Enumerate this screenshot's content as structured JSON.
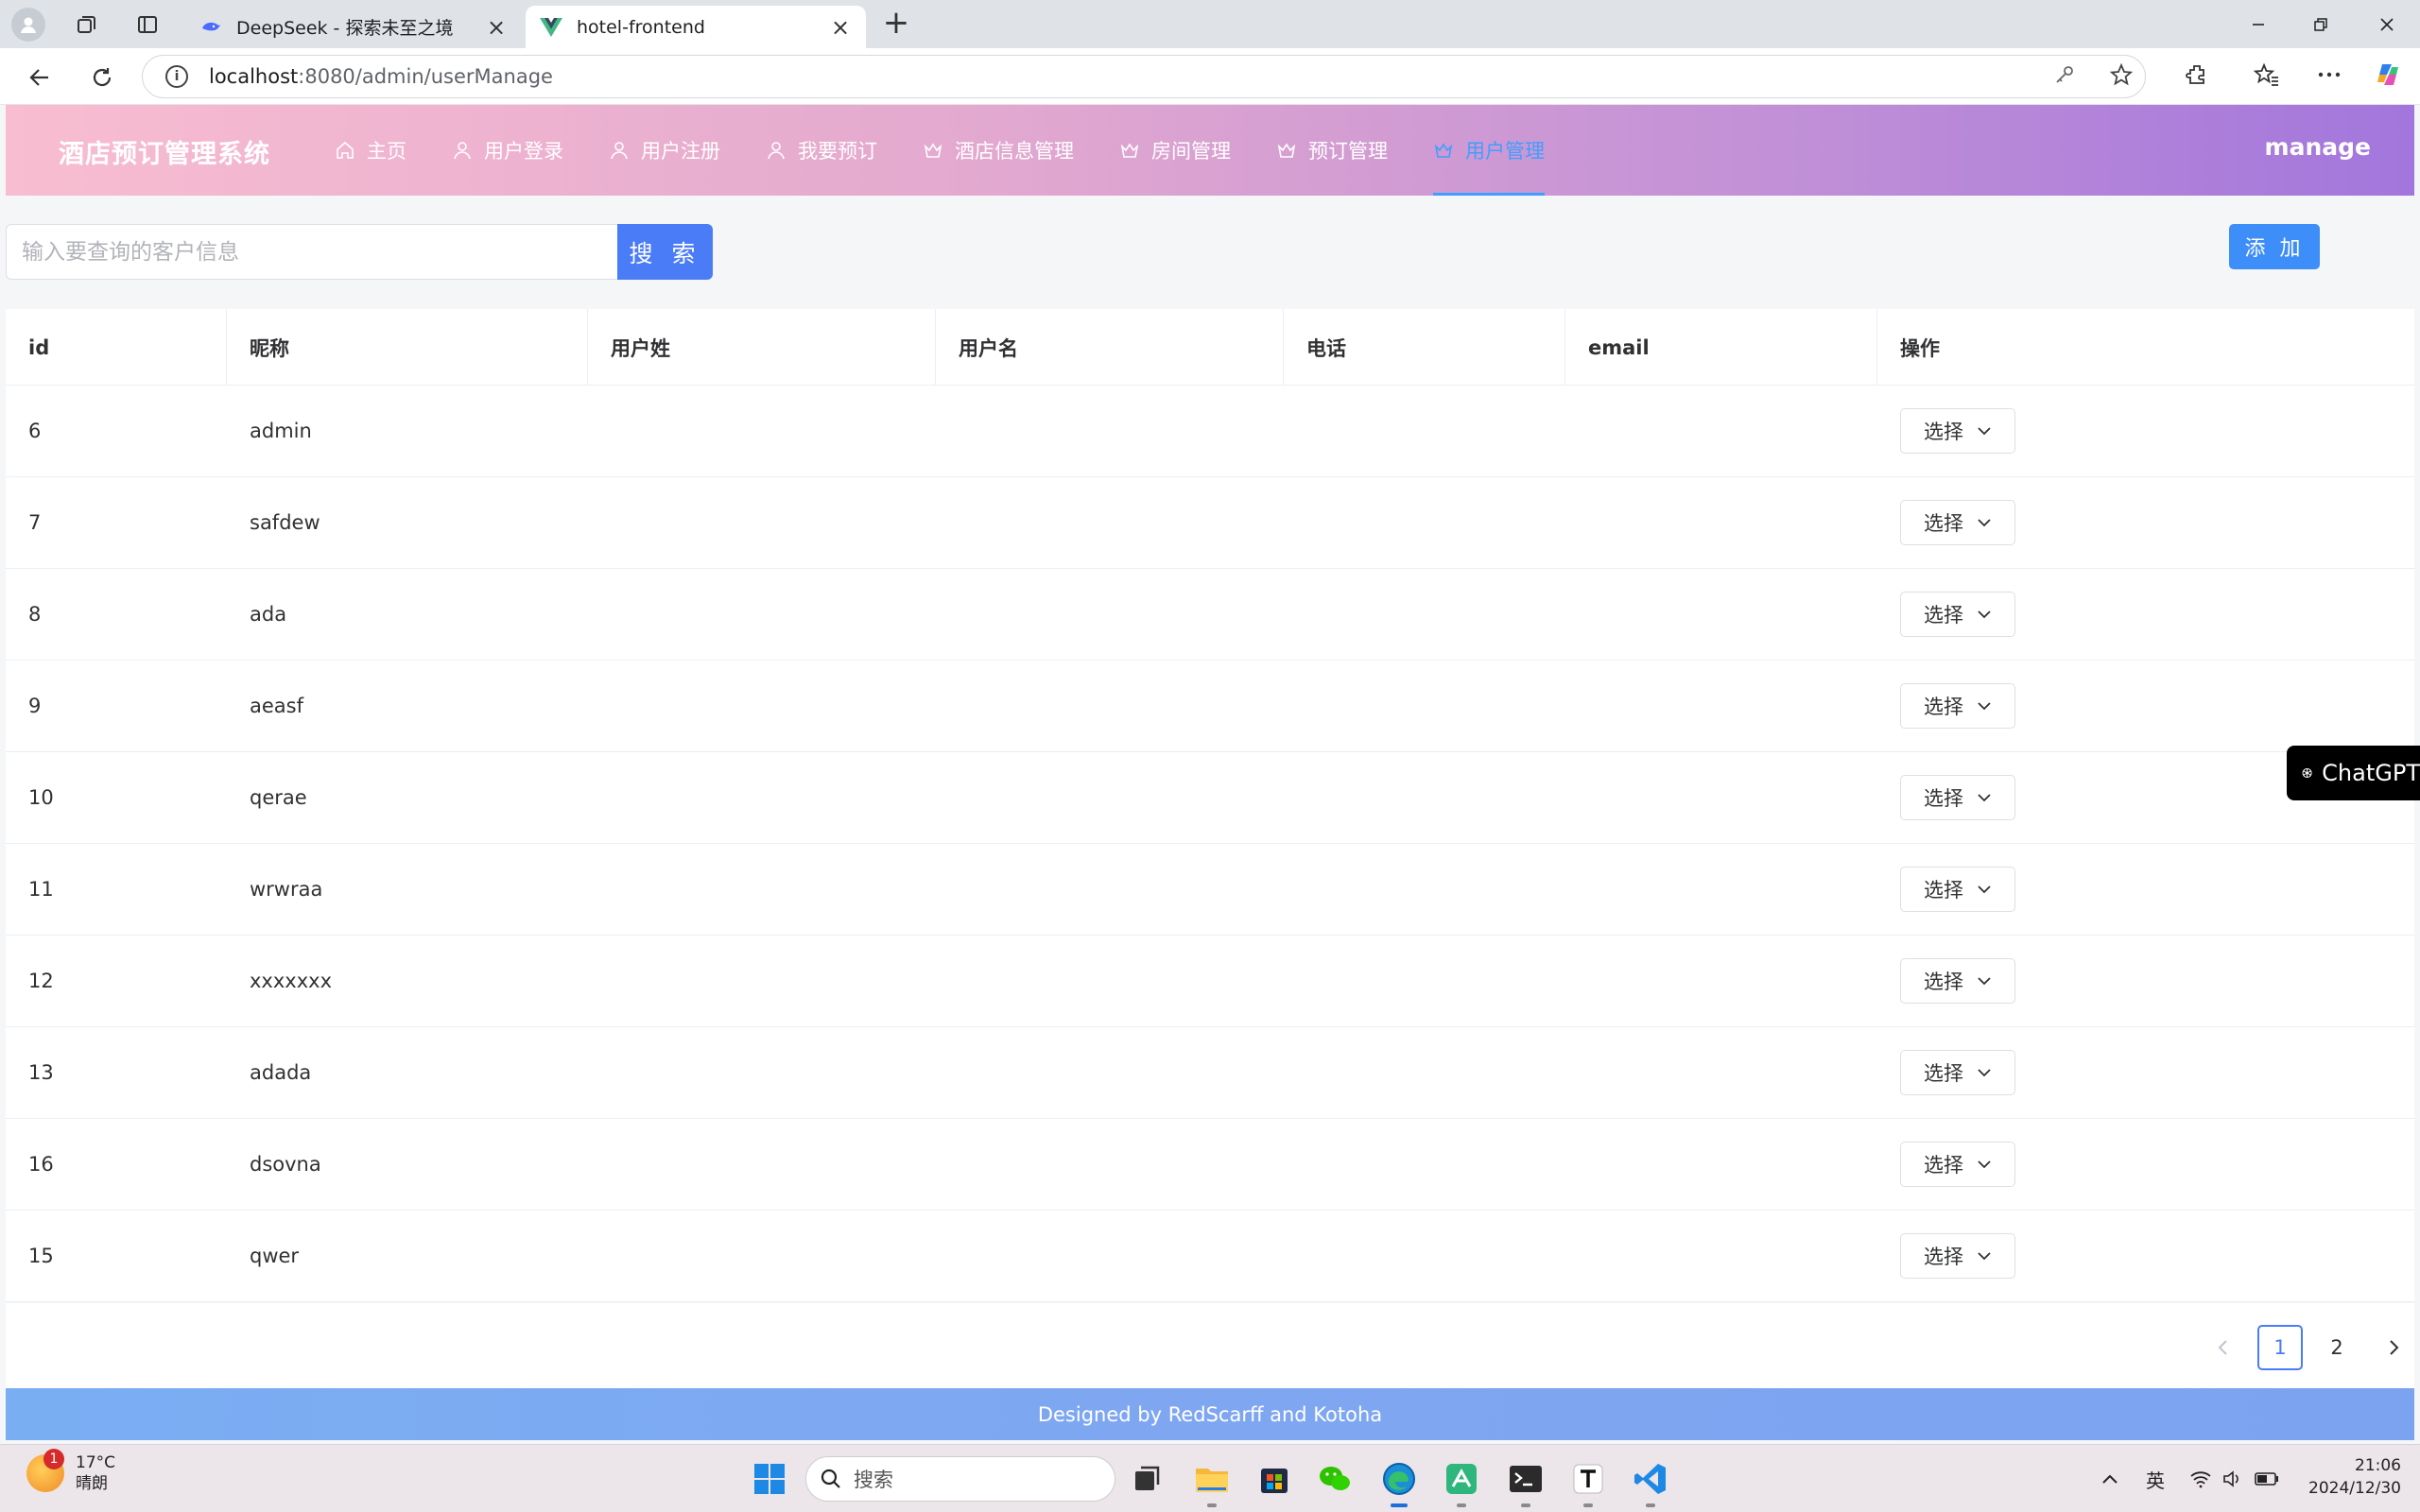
{
  "browser": {
    "tabs": [
      {
        "title": "DeepSeek - 探索未至之境",
        "icon": "deepseek-whale-icon"
      },
      {
        "title": "hotel-frontend",
        "icon": "vue-logo-icon"
      }
    ],
    "new_tab_symbol": "+",
    "url_host": "localhost",
    "url_path": ":8080/admin/userManage"
  },
  "header": {
    "brand": "酒店预订管理系统",
    "menu": [
      {
        "label": "主页",
        "icon": "home-icon"
      },
      {
        "label": "用户登录",
        "icon": "user-icon"
      },
      {
        "label": "用户注册",
        "icon": "user-icon"
      },
      {
        "label": "我要预订",
        "icon": "user-icon"
      },
      {
        "label": "酒店信息管理",
        "icon": "crown-icon"
      },
      {
        "label": "房间管理",
        "icon": "crown-icon"
      },
      {
        "label": "预订管理",
        "icon": "crown-icon"
      },
      {
        "label": "用户管理",
        "icon": "crown-icon",
        "active": true
      }
    ],
    "user": "manage",
    "accent_color": "#409eff"
  },
  "search": {
    "placeholder": "输入要查询的客户信息",
    "button_label": "搜 索",
    "add_label": "添 加"
  },
  "table": {
    "columns": [
      "id",
      "昵称",
      "用户姓",
      "用户名",
      "电话",
      "email",
      "操作"
    ],
    "action_label": "选择",
    "rows": [
      {
        "id": "6",
        "nickname": "admin"
      },
      {
        "id": "7",
        "nickname": "safdew"
      },
      {
        "id": "8",
        "nickname": "ada"
      },
      {
        "id": "9",
        "nickname": "aeasf"
      },
      {
        "id": "10",
        "nickname": "qerae"
      },
      {
        "id": "11",
        "nickname": "wrwraa"
      },
      {
        "id": "12",
        "nickname": "xxxxxxx"
      },
      {
        "id": "13",
        "nickname": "adada"
      },
      {
        "id": "16",
        "nickname": "dsovna"
      },
      {
        "id": "15",
        "nickname": "qwer"
      }
    ]
  },
  "pagination": {
    "pages": [
      "1",
      "2"
    ],
    "current": "1"
  },
  "footer": {
    "text": "Designed by RedScarff and Kotoha"
  },
  "widget": {
    "label": "ChatGPT"
  },
  "taskbar": {
    "weather_temp": "17°C",
    "weather_desc": "晴朗",
    "weather_badge": "1",
    "search_placeholder": "搜索",
    "ime": "英",
    "time": "21:06",
    "date": "2024/12/30"
  }
}
